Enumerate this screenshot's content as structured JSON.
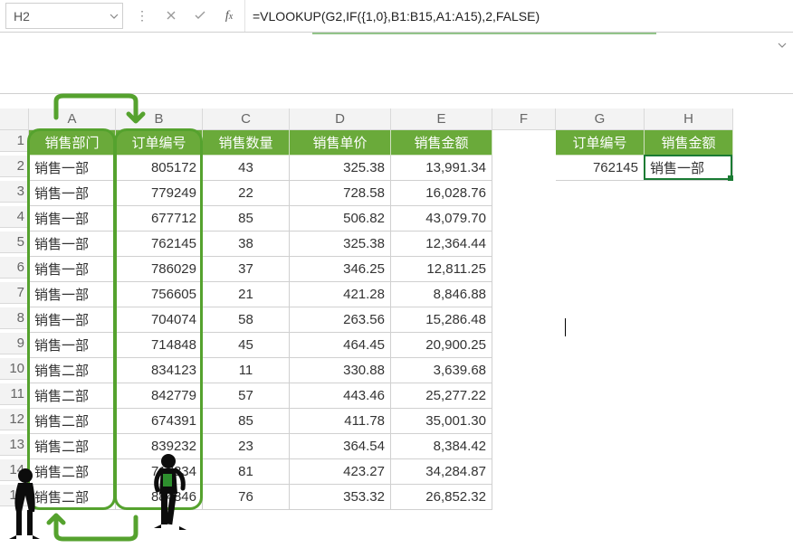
{
  "namebox": {
    "value": "H2"
  },
  "formula": "=VLOOKUP(G2,IF({1,0},B1:B15,A1:A15),2,FALSE)",
  "columns": [
    "A",
    "B",
    "C",
    "D",
    "E",
    "F",
    "G",
    "H"
  ],
  "main": {
    "headers": {
      "A": "销售部门",
      "B": "订单编号",
      "C": "销售数量",
      "D": "销售单价",
      "E": "销售金额"
    },
    "rows": [
      {
        "a": "销售一部",
        "b": "805172",
        "c": "43",
        "d": "325.38",
        "e": "13,991.34"
      },
      {
        "a": "销售一部",
        "b": "779249",
        "c": "22",
        "d": "728.58",
        "e": "16,028.76"
      },
      {
        "a": "销售一部",
        "b": "677712",
        "c": "85",
        "d": "506.82",
        "e": "43,079.70"
      },
      {
        "a": "销售一部",
        "b": "762145",
        "c": "38",
        "d": "325.38",
        "e": "12,364.44"
      },
      {
        "a": "销售一部",
        "b": "786029",
        "c": "37",
        "d": "346.25",
        "e": "12,811.25"
      },
      {
        "a": "销售一部",
        "b": "756605",
        "c": "21",
        "d": "421.28",
        "e": "8,846.88"
      },
      {
        "a": "销售一部",
        "b": "704074",
        "c": "58",
        "d": "263.56",
        "e": "15,286.48"
      },
      {
        "a": "销售一部",
        "b": "714848",
        "c": "45",
        "d": "464.45",
        "e": "20,900.25"
      },
      {
        "a": "销售二部",
        "b": "834123",
        "c": "11",
        "d": "330.88",
        "e": "3,639.68"
      },
      {
        "a": "销售二部",
        "b": "842779",
        "c": "57",
        "d": "443.46",
        "e": "25,277.22"
      },
      {
        "a": "销售二部",
        "b": "674391",
        "c": "85",
        "d": "411.78",
        "e": "35,001.30"
      },
      {
        "a": "销售二部",
        "b": "839232",
        "c": "23",
        "d": "364.54",
        "e": "8,384.42"
      },
      {
        "a": "销售二部",
        "b": "717834",
        "c": "81",
        "d": "423.27",
        "e": "34,284.87"
      },
      {
        "a": "销售二部",
        "b": "884846",
        "c": "76",
        "d": "353.32",
        "e": "26,852.32"
      }
    ]
  },
  "lookup": {
    "headers": {
      "G": "订单编号",
      "H": "销售金额"
    },
    "G2": "762145",
    "H2": "销售一部"
  },
  "colors": {
    "accent": "#6aaa3a",
    "hl": "#55a22e",
    "active": "#1a7b33"
  }
}
